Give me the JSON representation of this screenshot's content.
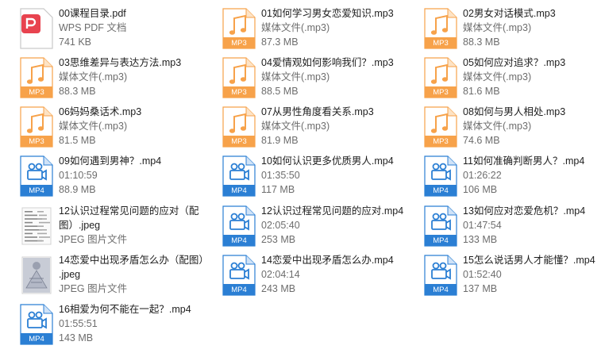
{
  "files": [
    {
      "name": "00课程目录.pdf",
      "line2": "WPS PDF 文档",
      "line3": "741 KB",
      "icon": "pdf-icon"
    },
    {
      "name": "01如何学习男女恋爱知识.mp3",
      "line2": "媒体文件(.mp3)",
      "line3": "87.3 MB",
      "icon": "mp3-icon",
      "badge": "MP3"
    },
    {
      "name": "02男女对话模式.mp3",
      "line2": "媒体文件(.mp3)",
      "line3": "88.3 MB",
      "icon": "mp3-icon",
      "badge": "MP3"
    },
    {
      "name": "03思维差异与表达方法.mp3",
      "line2": "媒体文件(.mp3)",
      "line3": "88.3 MB",
      "icon": "mp3-icon",
      "badge": "MP3"
    },
    {
      "name": "04爱情观如何影响我们？.mp3",
      "line2": "媒体文件(.mp3)",
      "line3": "88.5 MB",
      "icon": "mp3-icon",
      "badge": "MP3"
    },
    {
      "name": "05如何应对追求？.mp3",
      "line2": "媒体文件(.mp3)",
      "line3": "81.6 MB",
      "icon": "mp3-icon",
      "badge": "MP3"
    },
    {
      "name": "06妈妈桑话术.mp3",
      "line2": "媒体文件(.mp3)",
      "line3": "81.5 MB",
      "icon": "mp3-icon",
      "badge": "MP3"
    },
    {
      "name": "07从男性角度看关系.mp3",
      "line2": "媒体文件(.mp3)",
      "line3": "81.9 MB",
      "icon": "mp3-icon",
      "badge": "MP3"
    },
    {
      "name": "08如何与男人相处.mp3",
      "line2": "媒体文件(.mp3)",
      "line3": "74.6 MB",
      "icon": "mp3-icon",
      "badge": "MP3"
    },
    {
      "name": "09如何遇到男神？.mp4",
      "line2": "01:10:59",
      "line3": "88.9 MB",
      "icon": "mp4-icon",
      "badge": "MP4"
    },
    {
      "name": "10如何认识更多优质男人.mp4",
      "line2": "01:35:50",
      "line3": "117 MB",
      "icon": "mp4-icon",
      "badge": "MP4"
    },
    {
      "name": "11如何准确判断男人？.mp4",
      "line2": "01:26:22",
      "line3": "106 MB",
      "icon": "mp4-icon",
      "badge": "MP4"
    },
    {
      "name": "12认识过程常见问题的应对（配",
      "name2": "图）.jpeg",
      "line3": "JPEG 图片文件",
      "icon": "jpeg-thumbnail-icon"
    },
    {
      "name": "12认识过程常见问题的应对.mp4",
      "line2": "02:05:40",
      "line3": "253 MB",
      "icon": "mp4-icon",
      "badge": "MP4"
    },
    {
      "name": "13如何应对恋爱危机？.mp4",
      "line2": "01:47:54",
      "line3": "133 MB",
      "icon": "mp4-icon",
      "badge": "MP4"
    },
    {
      "name": "14恋爱中出现矛盾怎么办（配图）",
      "name2": ".jpeg",
      "line3": "JPEG 图片文件",
      "icon": "jpeg-thumbnail-icon"
    },
    {
      "name": "14恋爱中出现矛盾怎么办.mp4",
      "line2": "02:04:14",
      "line3": "243 MB",
      "icon": "mp4-icon",
      "badge": "MP4"
    },
    {
      "name": "15怎么说话男人才能懂？.mp4",
      "line2": "01:52:40",
      "line3": "137 MB",
      "icon": "mp4-icon",
      "badge": "MP4"
    },
    {
      "name": "16相爱为何不能在一起？.mp4",
      "line2": "01:55:51",
      "line3": "143 MB",
      "icon": "mp4-icon",
      "badge": "MP4"
    }
  ],
  "colors": {
    "mp3_orange": "#f7a24a",
    "mp4_blue": "#2b7fd4",
    "pdf_red": "#e8434f"
  }
}
